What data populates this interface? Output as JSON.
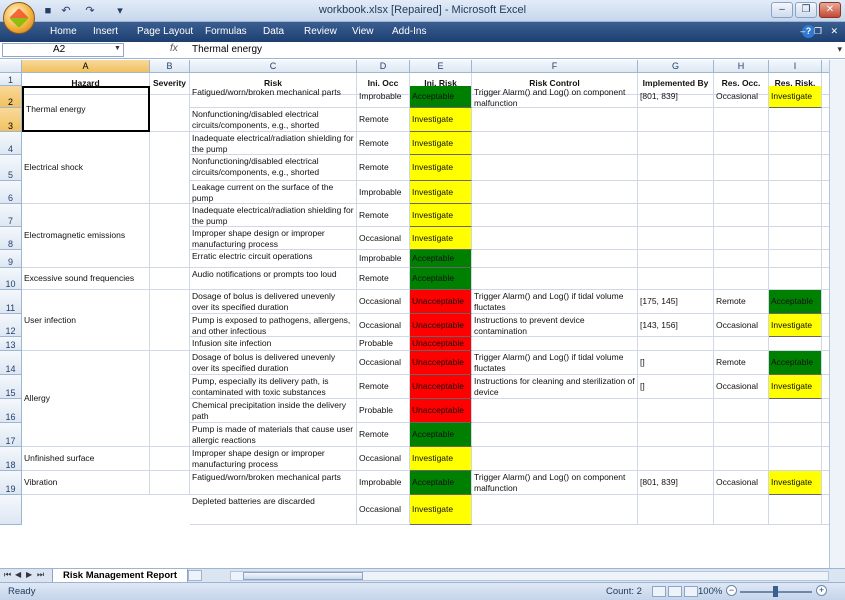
{
  "window": {
    "title": "workbook.xlsx [Repaired] - Microsoft Excel",
    "controls": [
      "–",
      "❐",
      "✕"
    ]
  },
  "qat_icons": [
    "save-icon",
    "undo-icon",
    "redo-icon",
    "customize-icon"
  ],
  "ribbon": {
    "tabs": [
      "Home",
      "Insert",
      "Page Layout",
      "Formulas",
      "Data",
      "Review",
      "View",
      "Add-Ins"
    ],
    "help": "?"
  },
  "formula_bar": {
    "name_box": "A2",
    "fx": "fx",
    "value": "Thermal energy"
  },
  "columns": [
    "A",
    "B",
    "C",
    "D",
    "E",
    "F",
    "G",
    "H",
    "I"
  ],
  "rows": [
    "1",
    "2",
    "3",
    "4",
    "5",
    "6",
    "7",
    "8",
    "9",
    "10",
    "11",
    "12",
    "13",
    "14",
    "15",
    "16",
    "17",
    "18",
    "19"
  ],
  "colors": {
    "acceptable": "#008000",
    "investigate": "#ffff00",
    "unacceptable": "#ff0000",
    "selected_header": "#f1c15f"
  },
  "headers": [
    "Hazard",
    "Severity",
    "Risk",
    "Ini. Occ",
    "Ini. Risk",
    "Risk Control",
    "Implemented By",
    "Res. Occ.",
    "Res. Risk."
  ],
  "hazards": [
    {
      "label": "Thermal energy",
      "rows": [
        2,
        3
      ]
    },
    {
      "label": "Electrical shock",
      "rows": [
        4,
        6
      ]
    },
    {
      "label": "Electromagnetic emissions",
      "rows": [
        7,
        9
      ]
    },
    {
      "label": "Excessive sound frequencies",
      "rows": [
        10,
        10
      ]
    },
    {
      "label": "User infection",
      "rows": [
        11,
        13
      ]
    },
    {
      "label": "Allergy",
      "rows": [
        14,
        17
      ]
    },
    {
      "label": "Unfinished surface",
      "rows": [
        18,
        18
      ]
    },
    {
      "label": "Vibration",
      "rows": [
        19,
        19
      ]
    }
  ],
  "data_rows": [
    {
      "row": 2,
      "risk": "Fatigued/worn/broken mechanical parts",
      "occ": "Improbable",
      "ini_risk": "Acceptable",
      "control": "Trigger Alarm() and Log() on component malfunction",
      "impl": "[801, 839]",
      "res_occ": "Occasional",
      "res_risk": "Investigate"
    },
    {
      "row": 3,
      "risk": "Nonfunctioning/disabled electrical circuits/components, e.g., shorted electrical circuits",
      "occ": "Remote",
      "ini_risk": "Investigate",
      "control": "",
      "impl": "",
      "res_occ": "",
      "res_risk": ""
    },
    {
      "row": 4,
      "risk": "Inadequate electrical/radiation shielding for the pump",
      "occ": "Remote",
      "ini_risk": "Investigate",
      "control": "",
      "impl": "",
      "res_occ": "",
      "res_risk": ""
    },
    {
      "row": 5,
      "risk": "Nonfunctioning/disabled electrical circuits/components, e.g., shorted electrical circuits.",
      "occ": "Remote",
      "ini_risk": "Investigate",
      "control": "",
      "impl": "",
      "res_occ": "",
      "res_risk": ""
    },
    {
      "row": 6,
      "risk": "Leakage current on the surface of the pump",
      "occ": "Improbable",
      "ini_risk": "Investigate",
      "control": "",
      "impl": "",
      "res_occ": "",
      "res_risk": ""
    },
    {
      "row": 7,
      "risk": "Inadequate electrical/radiation shielding for the pump",
      "occ": "Remote",
      "ini_risk": "Investigate",
      "control": "",
      "impl": "",
      "res_occ": "",
      "res_risk": ""
    },
    {
      "row": 8,
      "risk": "Improper shape design or improper manufacturing process",
      "occ": "Occasional",
      "ini_risk": "Investigate",
      "control": "",
      "impl": "",
      "res_occ": "",
      "res_risk": ""
    },
    {
      "row": 9,
      "risk": "Erratic electric circuit operations",
      "occ": "Improbable",
      "ini_risk": "Acceptable",
      "control": "",
      "impl": "",
      "res_occ": "",
      "res_risk": ""
    },
    {
      "row": 10,
      "risk": "Audio notifications or prompts too loud",
      "occ": "Remote",
      "ini_risk": "Acceptable",
      "control": "",
      "impl": "",
      "res_occ": "",
      "res_risk": ""
    },
    {
      "row": 11,
      "risk": "Dosage of bolus is delivered unevenly over its specified duration",
      "occ": "Occasional",
      "ini_risk": "Unacceptable",
      "control": "Trigger Alarm() and Log() if tidal volume fluctates",
      "impl": "[175, 145]",
      "res_occ": "Remote",
      "res_risk": "Acceptable"
    },
    {
      "row": 12,
      "risk": "Pump is exposed to pathogens, allergens, and other infectious",
      "occ": "Occasional",
      "ini_risk": "Unacceptable",
      "control": "Instructions to prevent device contamination",
      "impl": "[143, 156]",
      "res_occ": "Occasional",
      "res_risk": "Investigate"
    },
    {
      "row": 13,
      "risk": "Infusion site infection",
      "occ": "Probable",
      "ini_risk": "Unacceptable",
      "control": "",
      "impl": "",
      "res_occ": "",
      "res_risk": ""
    },
    {
      "row": 14,
      "risk": "Dosage of bolus is delivered unevenly over its specified duration",
      "occ": "Occasional",
      "ini_risk": "Unacceptable",
      "control": "Trigger Alarm() and Log() if tidal volume fluctates",
      "impl": "[]",
      "res_occ": "Remote",
      "res_risk": "Acceptable"
    },
    {
      "row": 15,
      "risk": "Pump, especially its delivery path, is contaminated with toxic substances",
      "occ": "Remote",
      "ini_risk": "Unacceptable",
      "control": "Instructions for cleaning and sterilization of device",
      "impl": "[]",
      "res_occ": "Occasional",
      "res_risk": "Investigate"
    },
    {
      "row": 16,
      "risk": "Chemical precipitation inside the delivery path",
      "occ": "Probable",
      "ini_risk": "Unacceptable",
      "control": "",
      "impl": "",
      "res_occ": "",
      "res_risk": ""
    },
    {
      "row": 17,
      "risk": "Pump is made of materials that cause user allergic reactions",
      "occ": "Remote",
      "ini_risk": "Acceptable",
      "control": "",
      "impl": "",
      "res_occ": "",
      "res_risk": ""
    },
    {
      "row": 18,
      "risk": "Improper shape design or improper manufacturing process",
      "occ": "Occasional",
      "ini_risk": "Investigate",
      "control": "",
      "impl": "",
      "res_occ": "",
      "res_risk": ""
    },
    {
      "row": 19,
      "risk": "Fatigued/worn/broken mechanical parts",
      "occ": "Improbable",
      "ini_risk": "Acceptable",
      "control": "Trigger Alarm() and Log() on component malfunction",
      "impl": "[801, 839]",
      "res_occ": "Occasional",
      "res_risk": "Investigate"
    },
    {
      "row": 20,
      "risk": "Depleted batteries are discarded",
      "occ": "Occasional",
      "ini_risk": "Investigate",
      "control": "",
      "impl": "",
      "res_occ": "",
      "res_risk": ""
    }
  ],
  "sheet": {
    "tab": "Risk Management Report"
  },
  "status": {
    "ready": "Ready",
    "count": "Count: 2",
    "zoom": "100%",
    "zoom_minus": "−",
    "zoom_plus": "+"
  }
}
